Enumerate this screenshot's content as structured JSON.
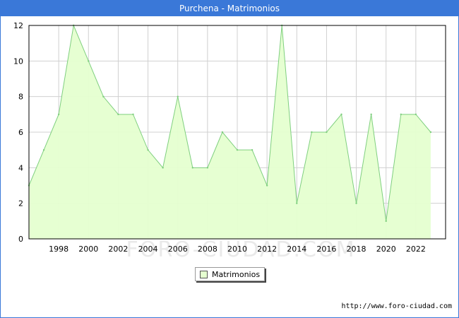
{
  "title": "Purchena - Matrimonios",
  "watermark": "FORO-CIUDAD.COM",
  "credit": "http://www.foro-ciudad.com",
  "colors": {
    "titlebar": "#3a78d8",
    "fill": "#e5ffd0",
    "line": "#7fcf7f",
    "grid": "#d0d0d0"
  },
  "chart_data": {
    "type": "area",
    "title": "Purchena - Matrimonios",
    "xlabel": "",
    "ylabel": "",
    "x": [
      1996,
      1997,
      1998,
      1999,
      2000,
      2001,
      2002,
      2003,
      2004,
      2005,
      2006,
      2007,
      2008,
      2009,
      2010,
      2011,
      2012,
      2013,
      2014,
      2015,
      2016,
      2017,
      2018,
      2019,
      2020,
      2021,
      2022,
      2023
    ],
    "series": [
      {
        "name": "Matrimonios",
        "values": [
          3,
          5,
          7,
          12,
          10,
          8,
          7,
          7,
          5,
          4,
          8,
          4,
          4,
          6,
          5,
          5,
          3,
          12,
          2,
          6,
          6,
          7,
          2,
          7,
          1,
          7,
          7,
          6
        ]
      }
    ],
    "xlim": [
      1996,
      2024
    ],
    "ylim": [
      0,
      12
    ],
    "xticks": [
      1998,
      2000,
      2002,
      2004,
      2006,
      2008,
      2010,
      2012,
      2014,
      2016,
      2018,
      2020,
      2022
    ],
    "yticks": [
      0,
      2,
      4,
      6,
      8,
      10,
      12
    ],
    "grid": true,
    "legend": "bottom-center"
  }
}
